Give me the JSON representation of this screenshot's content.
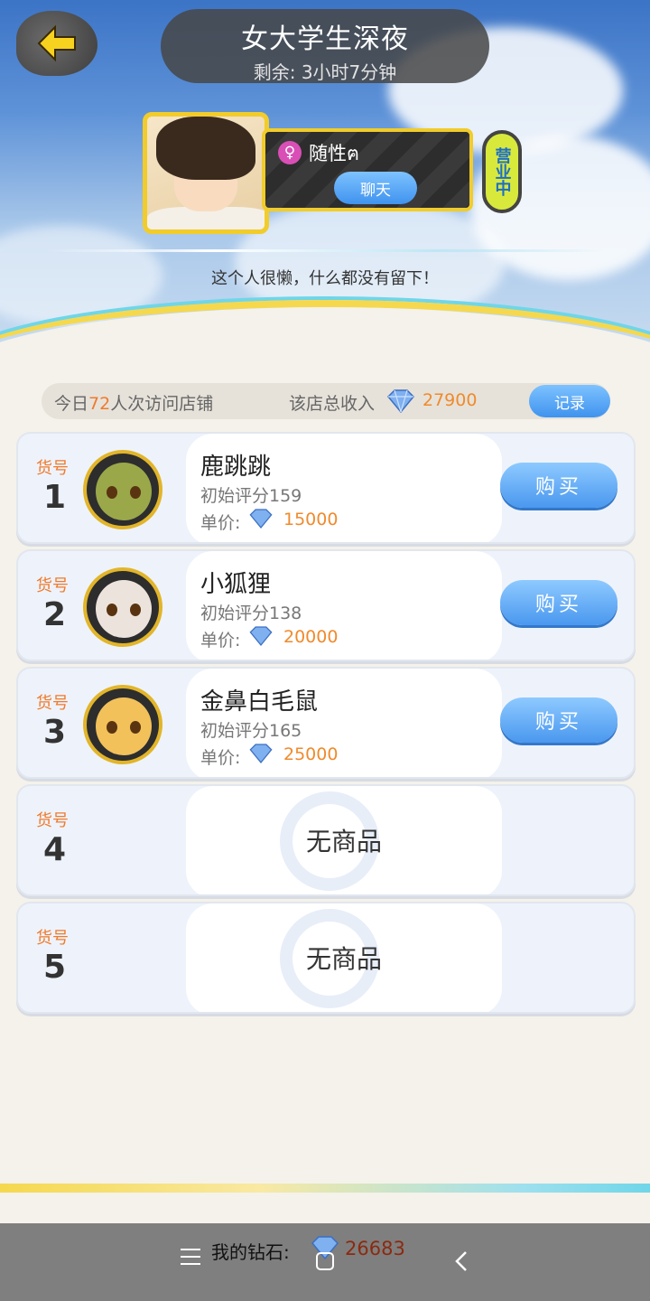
{
  "header": {
    "title": "女大学生深夜",
    "remaining": "剩余: 3小时7分钟"
  },
  "owner": {
    "name": "随性ฅ",
    "gender_symbol": "♀",
    "chat_label": "聊天",
    "status_label": "营业中",
    "bio": "这个人很懒，什么都没有留下！"
  },
  "stats": {
    "visit_prefix": "今日",
    "visit_count": "72",
    "visit_suffix": "人次访问店铺",
    "income_label": "该店总收入",
    "income_value": "27900",
    "record_label": "记录"
  },
  "slots": [
    {
      "label": "货号",
      "num": "1",
      "name": "鹿跳跳",
      "score": "初始评分159",
      "price_label": "单价:",
      "price": "15000",
      "buy": "购买",
      "color": "#9aa84a"
    },
    {
      "label": "货号",
      "num": "2",
      "name": "小狐狸",
      "score": "初始评分138",
      "price_label": "单价:",
      "price": "20000",
      "buy": "购买",
      "color": "#ece4dc"
    },
    {
      "label": "货号",
      "num": "3",
      "name": "金鼻白毛鼠",
      "score": "初始评分165",
      "price_label": "单价:",
      "price": "25000",
      "buy": "购买",
      "color": "#f2c15a"
    },
    {
      "label": "货号",
      "num": "4",
      "empty": "无商品"
    },
    {
      "label": "货号",
      "num": "5",
      "empty": "无商品"
    }
  ],
  "footer": {
    "diamonds_label": "我的钻石:",
    "diamonds_value": "26683"
  },
  "icons": {
    "back": "arrow-left-icon",
    "gem": "diamond-icon",
    "nav_menu": "menu-icon",
    "nav_home": "home-icon",
    "nav_back": "chevron-left-icon"
  }
}
